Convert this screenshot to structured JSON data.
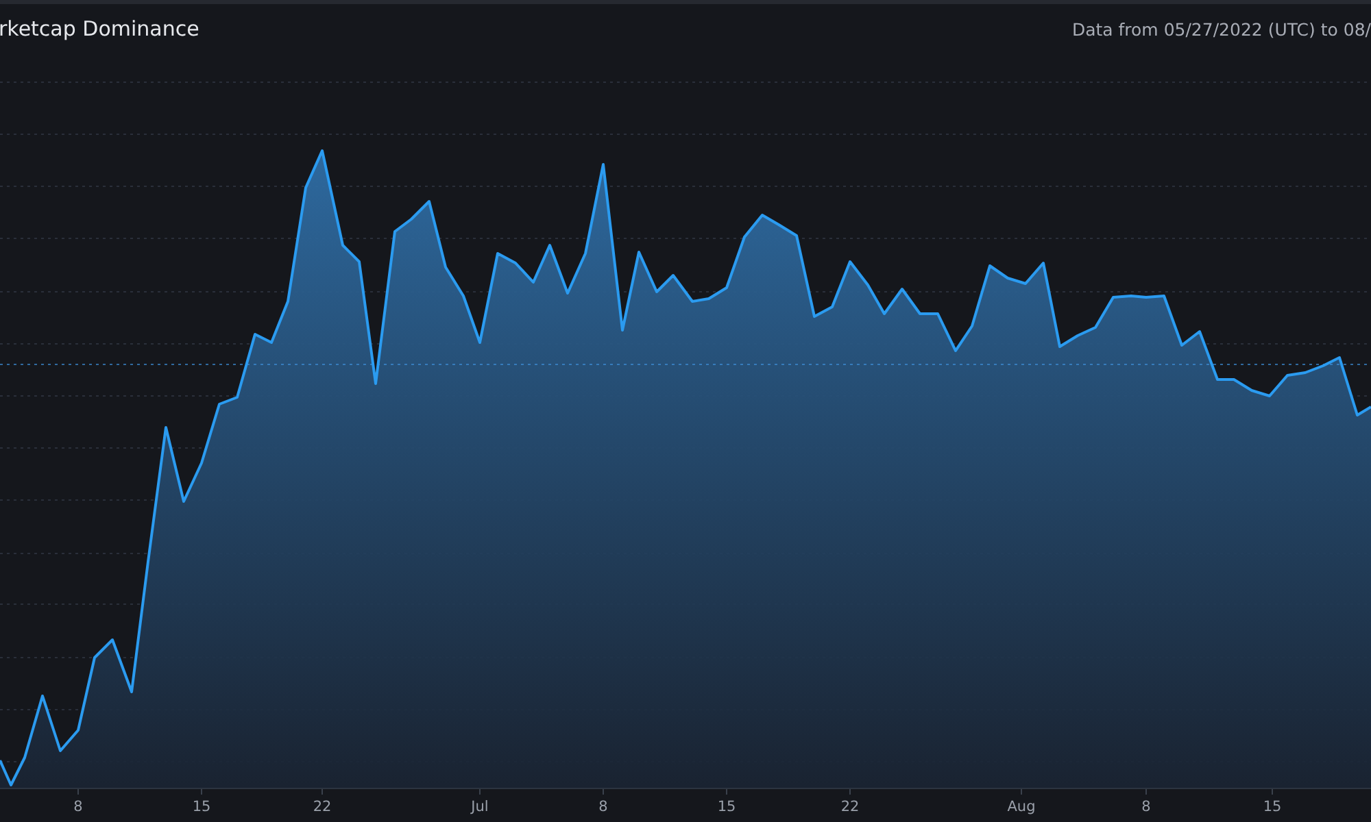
{
  "chart": {
    "title": "rketcap Dominance",
    "date_range": "Data from 05/27/2022 (UTC) to 08/",
    "x_labels": [
      "8",
      "15",
      "22",
      "Jul",
      "8",
      "15",
      "22",
      "Aug",
      "8",
      "15"
    ]
  }
}
